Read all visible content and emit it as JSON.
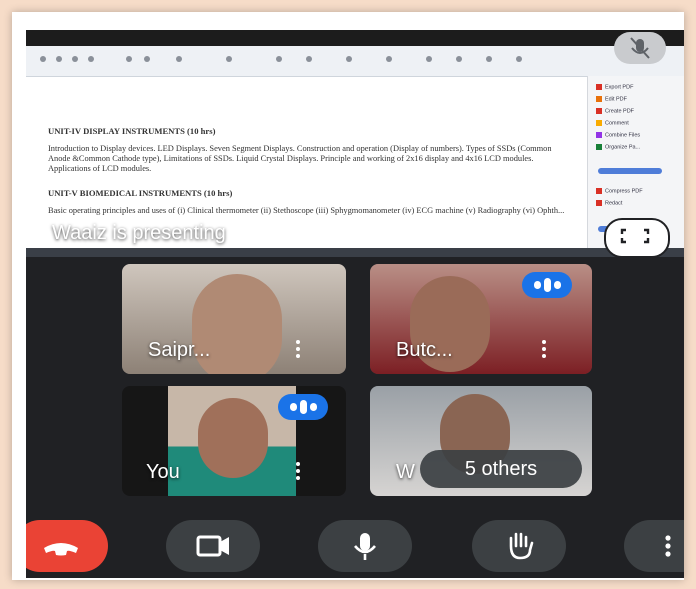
{
  "shared_screen": {
    "presenter_label": "Waaiz is presenting",
    "document": {
      "unit4_heading": "UNIT-IV DISPLAY INSTRUMENTS (10 hrs)",
      "unit4_body": "Introduction to Display devices. LED Displays. Seven Segment Displays. Construction and operation (Display of numbers). Types of SSDs (Common Anode &Common Cathode type), Limitations of SSDs. Liquid Crystal Displays. Principle and working of 2x16 display and 4x16 LCD modules. Applications of LCD modules.",
      "unit5_heading": "UNIT-V BIOMEDICAL INSTRUMENTS (10 hrs)",
      "unit5_body": "Basic operating principles and uses of (i) Clinical thermometer (ii) Stethoscope (iii) Sphygmomanometer (iv) ECG machine (v) Radiography (vi) Ophth..."
    },
    "side_panel": [
      {
        "label": "Export PDF",
        "color": "#d93025"
      },
      {
        "label": "Edit PDF",
        "color": "#e8710a"
      },
      {
        "label": "Create PDF",
        "color": "#d93025"
      },
      {
        "label": "Comment",
        "color": "#f9ab00"
      },
      {
        "label": "Combine Files",
        "color": "#9334e6"
      },
      {
        "label": "Organize Pa...",
        "color": "#188038"
      },
      {
        "label": "Compress PDF",
        "color": "#d93025"
      },
      {
        "label": "Redact",
        "color": "#d93025"
      }
    ]
  },
  "participants": [
    {
      "name": "Saipr...",
      "bg_top": "#cfc6bd",
      "bg_bottom": "#8d8176",
      "speaking": false
    },
    {
      "name": "Butc...",
      "bg_top": "#b98f86",
      "bg_bottom": "#7c1f24",
      "speaking": true
    },
    {
      "name": "You",
      "bg_top": "#c7b7a8",
      "bg_bottom": "#1f8a7a",
      "speaking": true
    },
    {
      "name": "W",
      "bg_top": "#9aa0a6",
      "bg_bottom": "#d6d4d2",
      "speaking": false
    }
  ],
  "others_label": "5 others",
  "controls": [
    {
      "name": "end-call-button",
      "icon": "phone-hangup-icon"
    },
    {
      "name": "camera-button",
      "icon": "video-camera-icon"
    },
    {
      "name": "microphone-button",
      "icon": "microphone-icon"
    },
    {
      "name": "raise-hand-button",
      "icon": "hand-icon"
    },
    {
      "name": "more-options-button",
      "icon": "more-vert-icon"
    }
  ],
  "colors": {
    "meet_dark": "#202124",
    "tile_bg": "#3c4043",
    "speaking_blue": "#1a73e8",
    "end_call_red": "#ea4335",
    "outer_bg": "#f6dcc8"
  }
}
